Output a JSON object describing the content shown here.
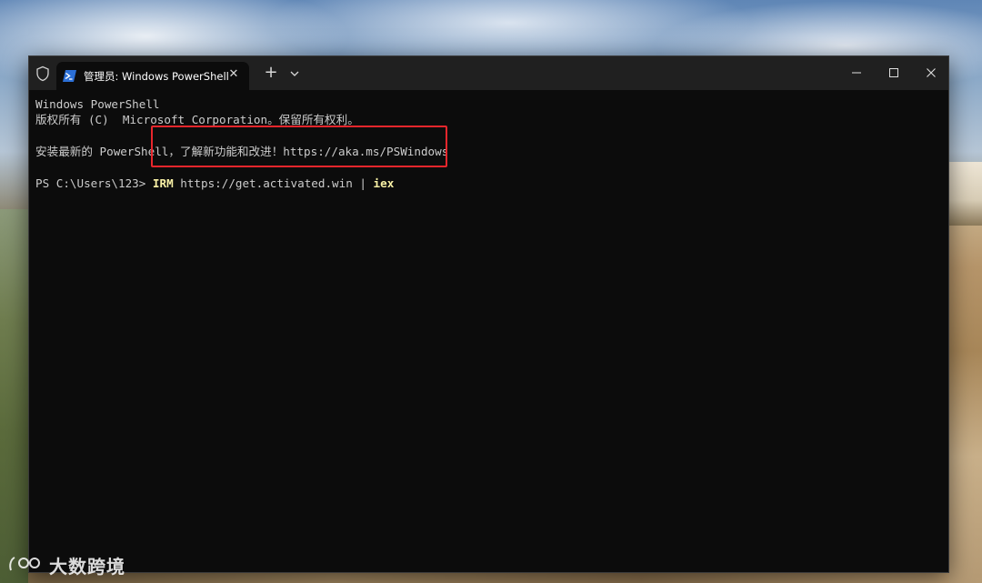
{
  "window": {
    "tab_title": "管理员: Windows PowerShell",
    "tab_close_glyph": "✕",
    "new_tab_glyph": "+"
  },
  "console": {
    "lines": [
      "Windows PowerShell",
      "版权所有 (C)  Microsoft Corporation。保留所有权利。",
      "",
      "安装最新的 PowerShell，了解新功能和改进！https://aka.ms/PSWindows",
      ""
    ],
    "prompt": "PS C:\\Users\\123> ",
    "command_keyword": "IRM",
    "command_args": " https://get.activated.win | ",
    "command_pipe_target": "iex"
  },
  "highlight": {
    "color": "#e8262c"
  },
  "watermark": {
    "text": "大数跨境"
  },
  "colors": {
    "console_bg": "#0c0c0c",
    "titlebar_bg": "#202020",
    "console_text": "#cccccc",
    "command_highlight": "#f9f1a5"
  },
  "icons": {
    "shield": "shield-icon",
    "powershell": "powershell-icon",
    "dropdown": "chevron-down-icon",
    "minimize": "minimize-icon",
    "maximize": "maximize-icon",
    "close": "close-icon"
  }
}
